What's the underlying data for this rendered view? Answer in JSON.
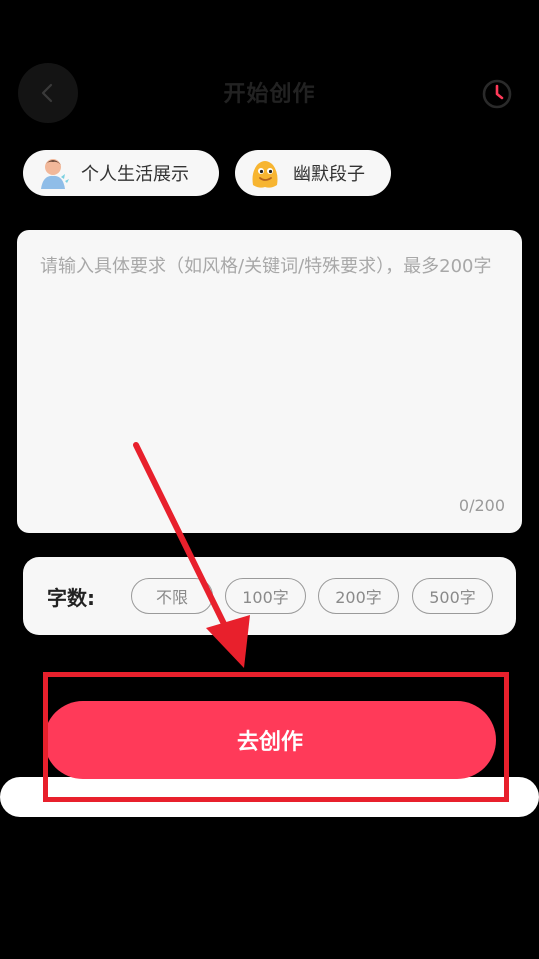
{
  "header": {
    "title": "开始创作",
    "back_icon": "chevron-left-icon",
    "history_icon": "clock-icon"
  },
  "topics": [
    {
      "label": "个人生活展示",
      "icon": "person-relaxing-emoji-icon"
    },
    {
      "label": "幽默段子",
      "icon": "melting-blob-emoji-icon"
    }
  ],
  "prompt": {
    "placeholder": "请输入具体要求（如风格/关键词/特殊要求），最多200字",
    "counter": "0/200"
  },
  "word_count": {
    "label": "字数:",
    "options": [
      "不限",
      "100字",
      "200字",
      "500字"
    ]
  },
  "create_button": {
    "label": "去创作"
  },
  "colors": {
    "background": "#000000",
    "card": "#f7f7f7",
    "accent": "#ff3a59",
    "annotation": "#e8202c"
  }
}
